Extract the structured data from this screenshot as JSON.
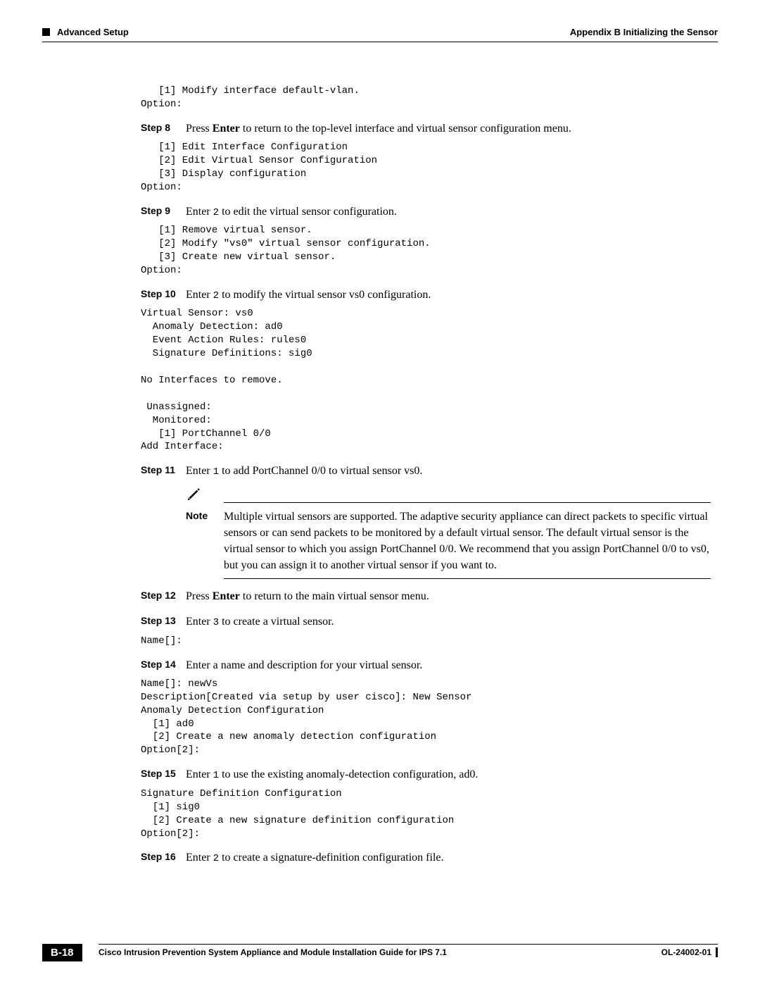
{
  "header": {
    "section": "Advanced Setup",
    "appendix": "Appendix B      Initializing the Sensor"
  },
  "code_top": "   [1] Modify interface default-vlan.\nOption:",
  "step8": {
    "label": "Step 8",
    "text_a": "Press ",
    "bold": "Enter",
    "text_b": " to return to the top-level interface and virtual sensor configuration menu.",
    "code": "   [1] Edit Interface Configuration\n   [2] Edit Virtual Sensor Configuration\n   [3] Display configuration\nOption:"
  },
  "step9": {
    "label": "Step 9",
    "text_a": "Enter ",
    "mono": "2",
    "text_b": " to edit the virtual sensor configuration.",
    "code": "   [1] Remove virtual sensor.\n   [2] Modify \"vs0\" virtual sensor configuration.\n   [3] Create new virtual sensor.\nOption:"
  },
  "step10": {
    "label": "Step 10",
    "text_a": "Enter ",
    "mono": "2",
    "text_b": " to modify the virtual sensor vs0 configuration.",
    "code": "Virtual Sensor: vs0\n  Anomaly Detection: ad0\n  Event Action Rules: rules0\n  Signature Definitions: sig0\n\nNo Interfaces to remove.\n\n Unassigned:\n  Monitored:\n   [1] PortChannel 0/0\nAdd Interface:"
  },
  "step11": {
    "label": "Step 11",
    "text_a": "Enter ",
    "mono": "1",
    "text_b": " to add PortChannel 0/0 to virtual sensor vs0."
  },
  "note": {
    "label": "Note",
    "text": "Multiple virtual sensors are supported. The adaptive security appliance can direct packets to specific virtual sensors or can send packets to be monitored by a default virtual sensor. The default virtual sensor is the virtual sensor to which you assign PortChannel 0/0. We recommend that you assign PortChannel 0/0 to vs0, but you can assign it to another virtual sensor if you want to."
  },
  "step12": {
    "label": "Step 12",
    "text_a": "Press ",
    "bold": "Enter",
    "text_b": " to return to the main virtual sensor menu."
  },
  "step13": {
    "label": "Step 13",
    "text_a": "Enter ",
    "mono": "3",
    "text_b": " to create a virtual sensor.",
    "code": "Name[]:"
  },
  "step14": {
    "label": "Step 14",
    "text": "Enter a name and description for your virtual sensor.",
    "code": "Name[]: newVs\nDescription[Created via setup by user cisco]: New Sensor\nAnomaly Detection Configuration\n  [1] ad0\n  [2] Create a new anomaly detection configuration\nOption[2]:"
  },
  "step15": {
    "label": "Step 15",
    "text_a": "Enter ",
    "mono": "1",
    "text_b": " to use the existing anomaly-detection configuration, ad0.",
    "code": "Signature Definition Configuration\n  [1] sig0\n  [2] Create a new signature definition configuration\nOption[2]:"
  },
  "step16": {
    "label": "Step 16",
    "text_a": "Enter ",
    "mono": "2",
    "text_b": " to create a signature-definition configuration file."
  },
  "footer": {
    "title": "Cisco Intrusion Prevention System Appliance and Module Installation Guide for IPS 7.1",
    "page": "B-18",
    "doc": "OL-24002-01"
  }
}
